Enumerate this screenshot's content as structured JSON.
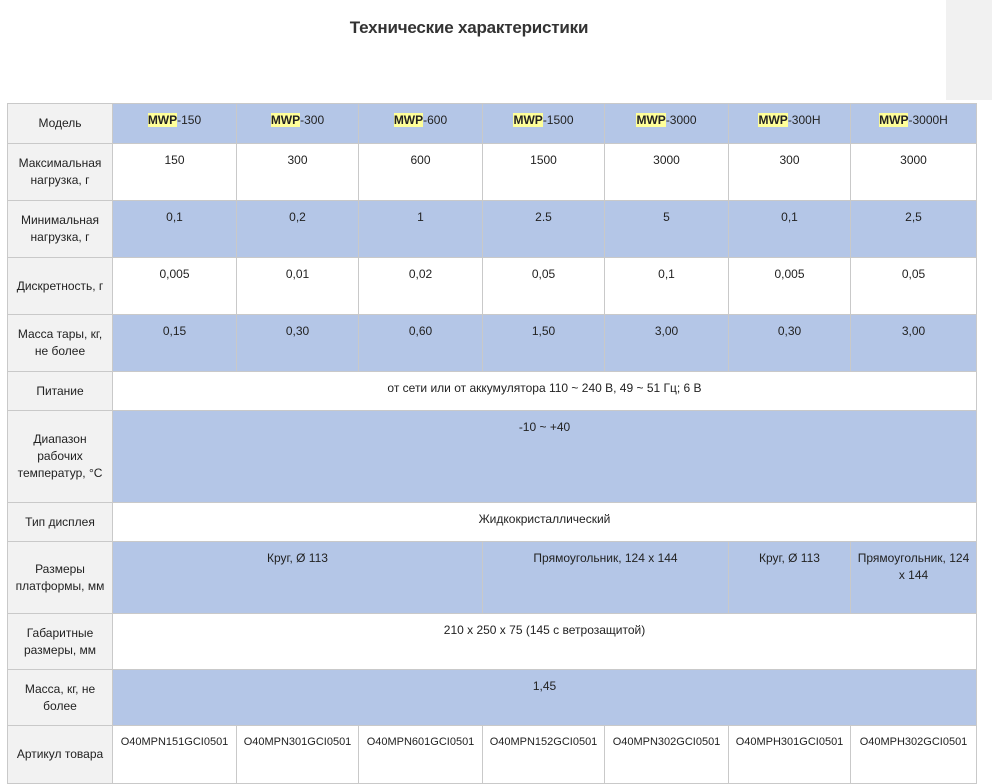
{
  "title": "Технические характеристики",
  "labels": {
    "model": "Модель",
    "max_load": "Максимальная нагрузка, г",
    "min_load": "Минимальная нагрузка, г",
    "discreteness": "Дискретность, г",
    "tare": "Масса тары, кг, не более",
    "power": "Питание",
    "temp_range": "Диапазон рабочих температур, °С",
    "display": "Тип дисплея",
    "platform": "Размеры платформы, мм",
    "dimensions": "Габаритные размеры, мм",
    "mass": "Масса, кг, не более",
    "sku": "Артикул товара"
  },
  "models": [
    {
      "prefix": "MWP",
      "suffix": "-150"
    },
    {
      "prefix": "MWP",
      "suffix": "-300"
    },
    {
      "prefix": "MWP",
      "suffix": "-600"
    },
    {
      "prefix": "MWP",
      "suffix": "-1500"
    },
    {
      "prefix": "MWP",
      "suffix": "-3000"
    },
    {
      "prefix": "MWP",
      "suffix": "-300H"
    },
    {
      "prefix": "MWP",
      "suffix": "-3000H"
    }
  ],
  "max_load": [
    "150",
    "300",
    "600",
    "1500",
    "3000",
    "300",
    "3000"
  ],
  "min_load": [
    "0,1",
    "0,2",
    "1",
    "2.5",
    "5",
    "0,1",
    "2,5"
  ],
  "discreteness": [
    "0,005",
    "0,01",
    "0,02",
    "0,05",
    "0,1",
    "0,005",
    "0,05"
  ],
  "tare": [
    "0,15",
    "0,30",
    "0,60",
    "1,50",
    "3,00",
    "0,30",
    "3,00"
  ],
  "power": "от сети или от аккумулятора 110 ~ 240 В, 49 ~ 51 Гц; 6 В",
  "temp_range": "-10 ~ +40",
  "display": "Жидкокристаллический",
  "platform": {
    "circle_1": "Круг, Ø 113",
    "rect_1": "Прямоугольник, 124 x 144",
    "circle_2": "Круг, Ø 113",
    "rect_2": "Прямоугольник, 124 x 144"
  },
  "dimensions": "210 x 250 x 75 (145 с ветрозащитой)",
  "mass": "1,45",
  "sku": [
    "O40MPN151GCI0501",
    "O40MPN301GCI0501",
    "O40MPN601GCI0501",
    "O40MPN152GCI0501",
    "O40MPN302GCI0501",
    "O40MPH301GCI0501",
    "O40MPH302GCI0501"
  ],
  "colors": {
    "blue_row": "#b4c6e7",
    "label_bg": "#f2f2f2",
    "highlight": "#ffff99",
    "border": "#c9c9c9"
  }
}
